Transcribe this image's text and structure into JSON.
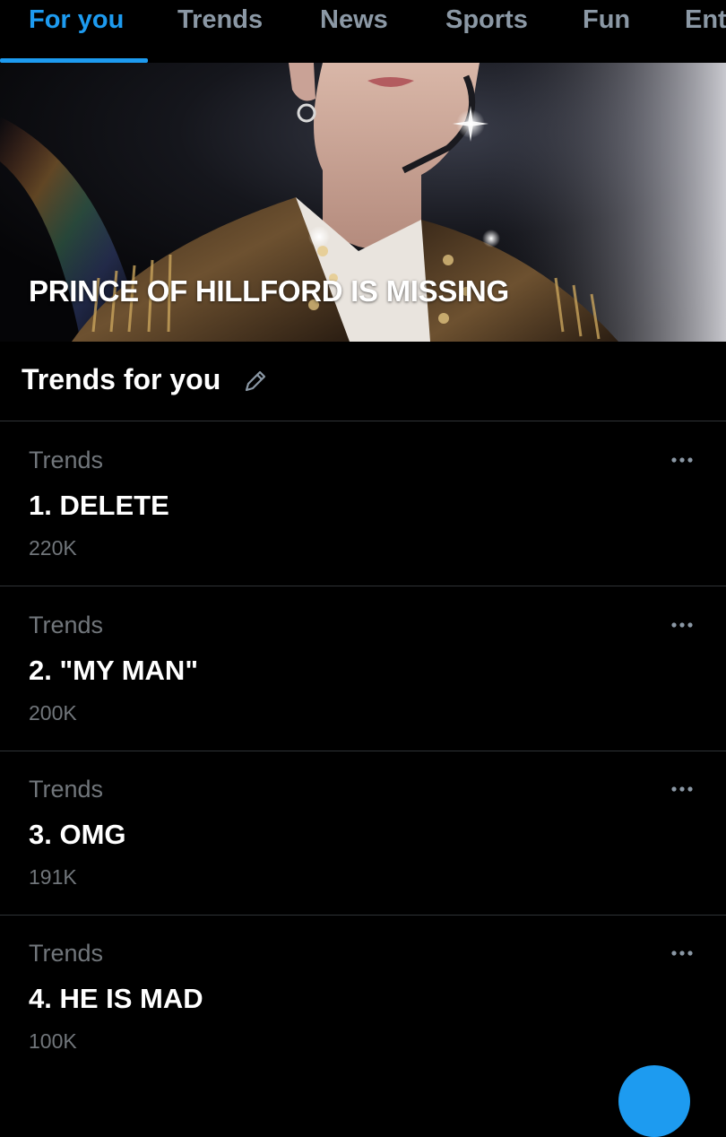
{
  "tabs": [
    {
      "label": "For you",
      "active": true
    },
    {
      "label": "Trends",
      "active": false
    },
    {
      "label": "News",
      "active": false
    },
    {
      "label": "Sports",
      "active": false
    },
    {
      "label": "Fun",
      "active": false
    },
    {
      "label": "Ent",
      "active": false
    }
  ],
  "hero": {
    "title": "PRINCE OF HILLFORD IS MISSING"
  },
  "section": {
    "title": "Trends for you",
    "edit_icon": "pencil-icon"
  },
  "trends": [
    {
      "context": "Trends",
      "name": "1. DELETE",
      "count": "220K"
    },
    {
      "context": "Trends",
      "name": "2. \"MY MAN\"",
      "count": "200K"
    },
    {
      "context": "Trends",
      "name": "3. OMG",
      "count": "191K"
    },
    {
      "context": "Trends",
      "name": "4. HE IS MAD",
      "count": "100K"
    }
  ],
  "icons": {
    "more": "more-horizontal-icon",
    "fab": "compose-icon"
  },
  "colors": {
    "accent": "#1d9bf0",
    "background": "#000000",
    "secondary_text": "#71767b",
    "divider": "#2f3336"
  }
}
